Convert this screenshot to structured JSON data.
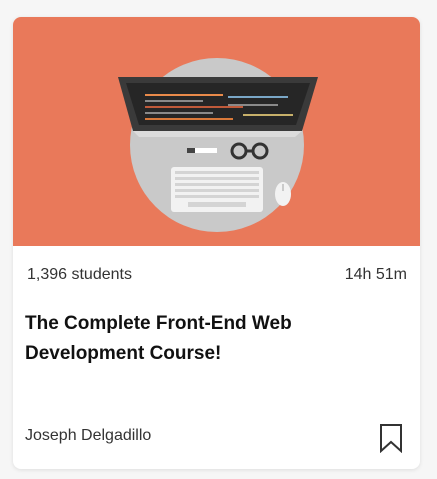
{
  "course": {
    "students": "1,396 students",
    "duration": "14h 51m",
    "title": "The Complete Front-End Web Development Course!",
    "author": "Joseph Delgadillo",
    "thumbnail_icon": "laptop-desk-illustration-icon",
    "bookmark_icon": "bookmark-icon"
  },
  "colors": {
    "thumbnail_bg": "#e9795a",
    "card_bg": "#ffffff",
    "text": "#222222"
  }
}
